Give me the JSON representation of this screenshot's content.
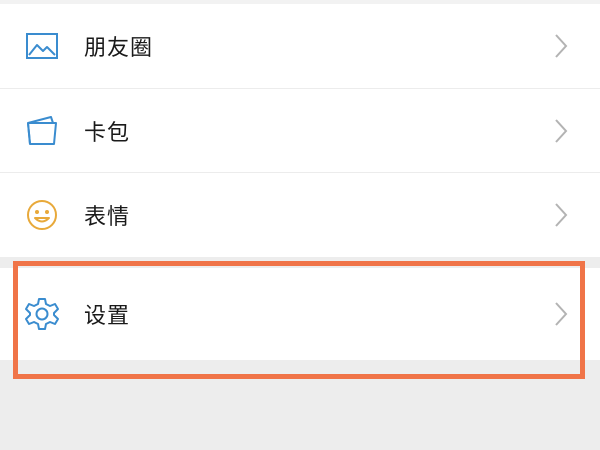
{
  "menu": {
    "items": [
      {
        "label": "朋友圈",
        "icon": "image-icon",
        "icon_color": "#3a8ccf"
      },
      {
        "label": "卡包",
        "icon": "wallet-icon",
        "icon_color": "#3a8ccf"
      },
      {
        "label": "表情",
        "icon": "smiley-icon",
        "icon_color": "#e8a93a"
      }
    ],
    "settings": {
      "label": "设置",
      "icon": "gear-icon",
      "icon_color": "#3a8ccf"
    }
  },
  "highlight": {
    "color": "#f07448",
    "target": "settings"
  },
  "colors": {
    "background": "#ededed",
    "row_background": "#ffffff",
    "text": "#1a1a1a",
    "chevron": "#b3b3b3",
    "divider": "#ececec"
  }
}
